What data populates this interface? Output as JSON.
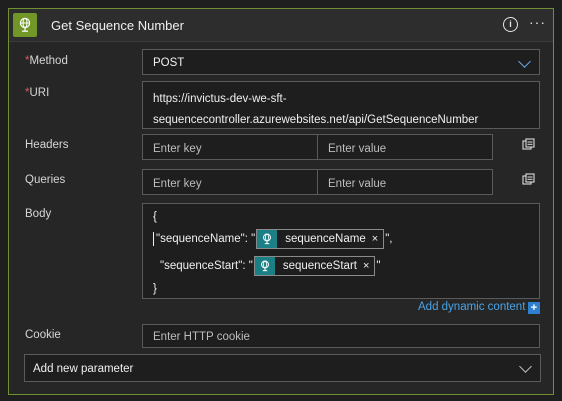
{
  "action": {
    "title": "Get Sequence Number",
    "icons": {
      "action": "globe-icon",
      "info": "info-icon",
      "more": "more-options-icon"
    }
  },
  "fields": {
    "method": {
      "required_mark": "*",
      "label": "Method",
      "value": "POST"
    },
    "uri": {
      "required_mark": "*",
      "label": "URI",
      "value_line1": "https://invictus-dev-we-sft-",
      "value_line2": "sequencecontroller.azurewebsites.net/api/GetSequenceNumber"
    },
    "headers": {
      "label": "Headers",
      "key_placeholder": "Enter key",
      "value_placeholder": "Enter value"
    },
    "queries": {
      "label": "Queries",
      "key_placeholder": "Enter key",
      "value_placeholder": "Enter value"
    },
    "body": {
      "label": "Body",
      "open_brace": "{",
      "close_brace": "}",
      "line1_key": "\"sequenceName\": \"",
      "line1_token": "sequenceName",
      "line1_end": "\",",
      "line2_key": "\"sequenceStart\": \"",
      "line2_token": "sequenceStart",
      "line2_end": "\"",
      "token_remove": "×"
    },
    "add_dynamic_content": "Add dynamic content",
    "add_dynamic_plus": "+",
    "cookie": {
      "label": "Cookie",
      "placeholder": "Enter HTTP cookie"
    },
    "add_new_parameter": "Add new parameter"
  },
  "colors": {
    "accent_green": "#709727",
    "token_teal": "#1b7f86",
    "link_blue": "#4aa3e8"
  }
}
